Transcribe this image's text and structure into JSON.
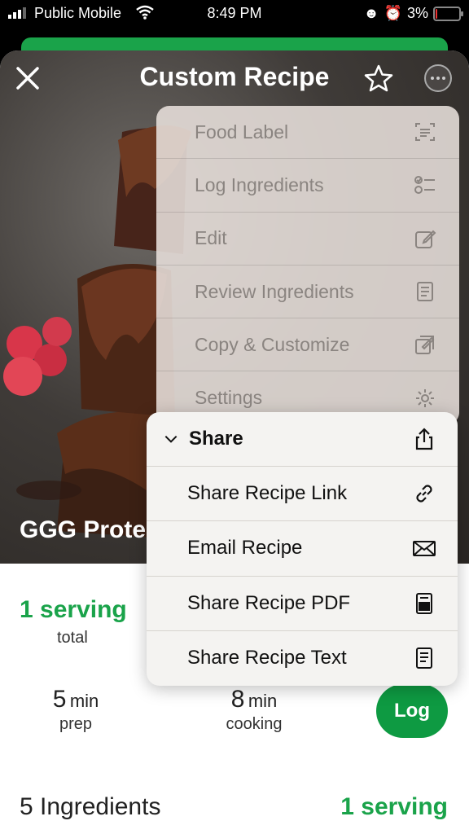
{
  "status_bar": {
    "carrier": "Public Mobile",
    "time": "8:49 PM",
    "battery": "3%",
    "battery_level": 0.03
  },
  "nav": {
    "title": "Custom Recipe"
  },
  "recipe": {
    "name": "GGG Prote"
  },
  "menu": {
    "items": [
      {
        "label": "Food Label",
        "icon": "food-label-icon"
      },
      {
        "label": "Log Ingredients",
        "icon": "checklist-icon"
      },
      {
        "label": "Edit",
        "icon": "edit-icon"
      },
      {
        "label": "Review Ingredients",
        "icon": "document-icon"
      },
      {
        "label": "Copy & Customize",
        "icon": "copy-edit-icon"
      },
      {
        "label": "Settings",
        "icon": "gear-icon"
      }
    ]
  },
  "share_menu": {
    "header": "Share",
    "items": [
      {
        "label": "Share Recipe Link",
        "icon": "link-icon"
      },
      {
        "label": "Email Recipe",
        "icon": "envelope-icon"
      },
      {
        "label": "Share Recipe PDF",
        "icon": "pdf-icon"
      },
      {
        "label": "Share Recipe Text",
        "icon": "text-document-icon"
      }
    ]
  },
  "summary": {
    "serving": "1 serving",
    "serving_sub": "total",
    "prep_num": "5",
    "prep_unit": "min",
    "prep_label": "prep",
    "cook_num": "8",
    "cook_unit": "min",
    "cook_label": "cooking",
    "log_label": "Log"
  },
  "ingredients": {
    "title": "5 Ingredients",
    "serving": "1 serving"
  },
  "colors": {
    "accent_green": "#1aa34a",
    "button_green": "#0e9a42"
  }
}
